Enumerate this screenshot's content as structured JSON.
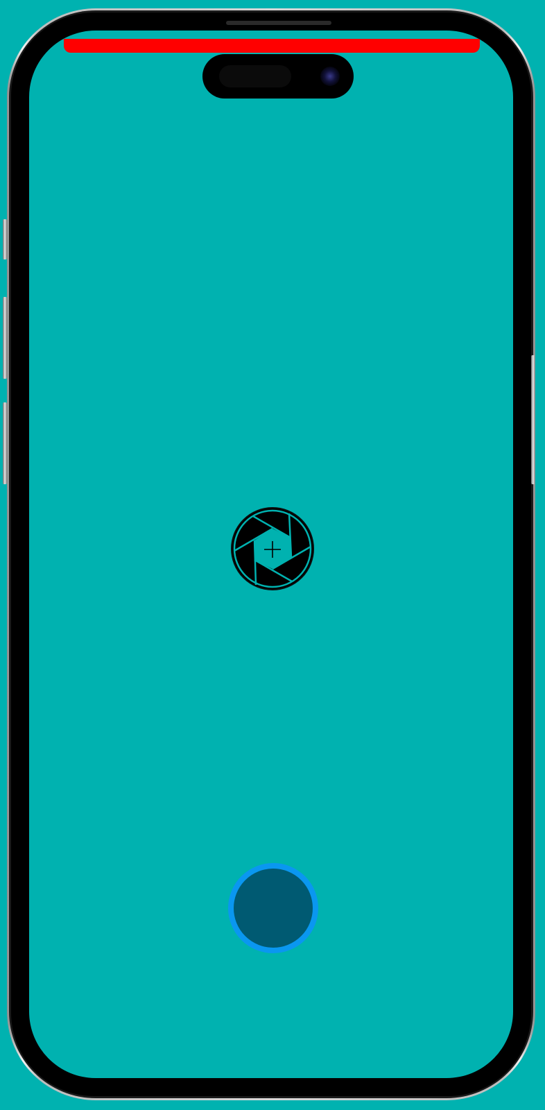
{
  "colors": {
    "background": "#00b2b0",
    "screen": "#00b2b0",
    "alert_bar": "#ff0000",
    "shutter_ring": "#0a97f0",
    "shutter_fill": "#005a72",
    "aperture_icon": "#000000"
  },
  "icons": {
    "center": "camera-aperture-icon",
    "crosshair": "crosshair-icon"
  },
  "controls": {
    "shutter": "capture-button"
  }
}
